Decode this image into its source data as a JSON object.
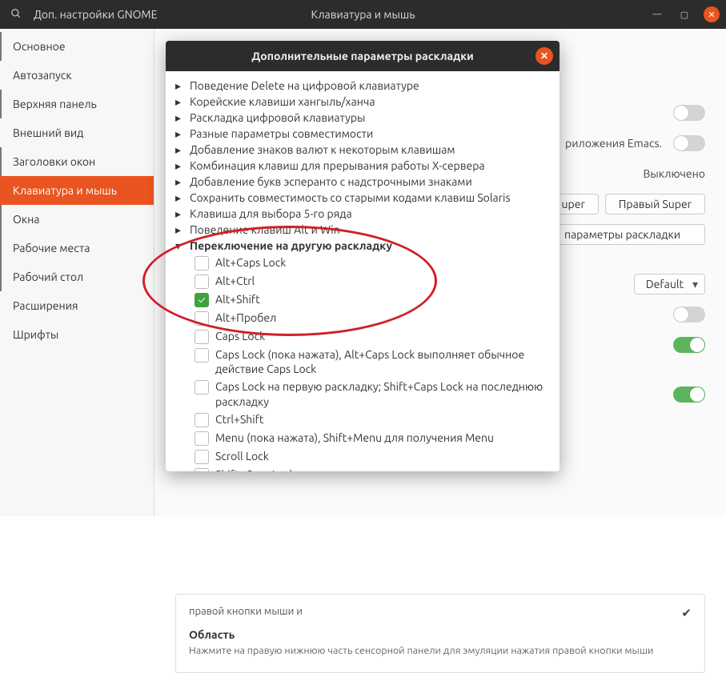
{
  "titlebar": {
    "app_title": "Доп. настройки GNOME",
    "section_title": "Клавиатура и мышь"
  },
  "sidebar": {
    "items": [
      {
        "label": "Основное"
      },
      {
        "label": "Автозапуск"
      },
      {
        "label": "Верхняя панель"
      },
      {
        "label": "Внешний вид"
      },
      {
        "label": "Заголовки окон"
      },
      {
        "label": "Клавиатура и мышь"
      },
      {
        "label": "Окна"
      },
      {
        "label": "Рабочие места"
      },
      {
        "label": "Рабочий стол"
      },
      {
        "label": "Расширения"
      },
      {
        "label": "Шрифты"
      }
    ],
    "active_index": 5,
    "indicator_indices": [
      0,
      2,
      4,
      6,
      7,
      8
    ]
  },
  "main": {
    "emacs_hint": "риложения Emacs.",
    "disabled_text": "Выключено",
    "super_right_btn": "Правый Super",
    "super_left_btn_suffix": "uper",
    "extra_layout_btn": "параметры раскладки",
    "default_select": "Default",
    "touchpad_click_text": "правой кнопки мыши и",
    "area_title": "Область",
    "area_desc": "Нажмите на правую нижнюю часть сенсорной панели для эмуляции нажатия правой кнопки мыши"
  },
  "dialog": {
    "title": "Дополнительные параметры раскладки",
    "collapsed_groups": [
      "Поведение Delete на цифровой клавиатуре",
      "Корейские клавиши хангыль/ханча",
      "Раскладка цифровой клавиатуры",
      "Разные параметры совместимости",
      "Добавление знаков валют к некоторым клавишам",
      "Комбинация клавиш для прерывания работы X-сервера",
      "Добавление букв эсперанто с надстрочными знаками",
      "Сохранить совместимость со старыми кодами клавиш Solaris",
      "Клавиша для выбора 5-го ряда",
      "Поведение клавиш Alt и Win"
    ],
    "expanded_group": "Переключение на другую раскладку",
    "options": [
      {
        "label": "Alt+Caps Lock",
        "checked": false
      },
      {
        "label": "Alt+Ctrl",
        "checked": false
      },
      {
        "label": "Alt+Shift",
        "checked": true
      },
      {
        "label": "Alt+Пробел",
        "checked": false
      },
      {
        "label": "Caps Lock",
        "checked": false
      },
      {
        "label": "Caps Lock (пока нажата), Alt+Caps Lock выполняет обычное действие Caps Lock",
        "checked": false
      },
      {
        "label": "Caps Lock на первую раскладку; Shift+Caps Lock на последнюю раскладку",
        "checked": false
      },
      {
        "label": "Ctrl+Shift",
        "checked": false
      },
      {
        "label": "Menu (пока нажата), Shift+Menu для получения Menu",
        "checked": false
      },
      {
        "label": "Scroll Lock",
        "checked": false
      },
      {
        "label": "Shift+Caps Lock",
        "checked": false
      }
    ]
  }
}
